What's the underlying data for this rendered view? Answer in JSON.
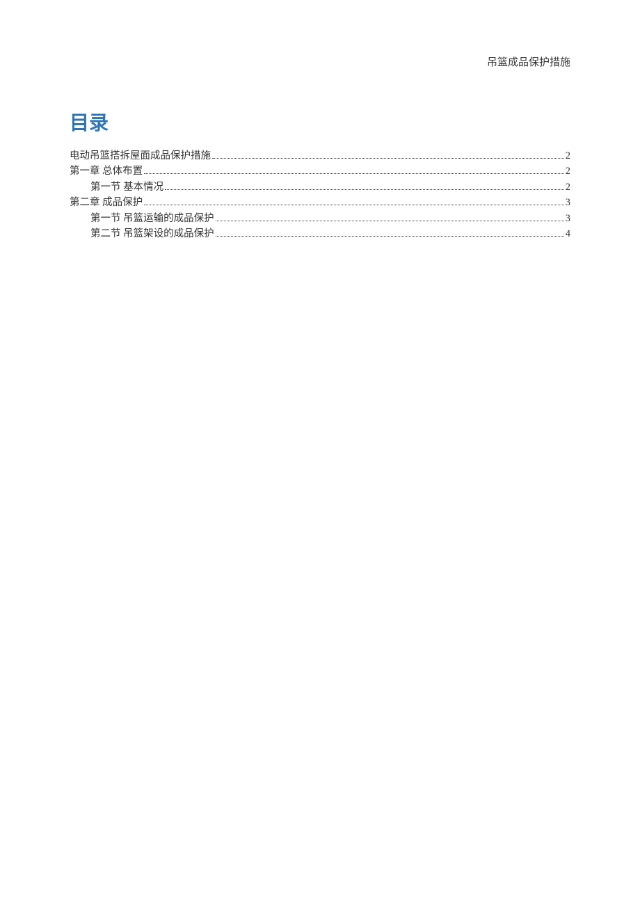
{
  "header": {
    "text": "吊篮成品保护措施"
  },
  "toc": {
    "title": "目录",
    "entries": [
      {
        "label": "电动吊篮搭拆屋面成品保护措施",
        "page": "2",
        "level": 1
      },
      {
        "label": "第一章 总体布置",
        "page": "2",
        "level": 1
      },
      {
        "label": "第一节 基本情况",
        "page": "2",
        "level": 2
      },
      {
        "label": "第二章 成品保护",
        "page": "3",
        "level": 1
      },
      {
        "label": "第一节 吊篮运输的成品保护",
        "page": "3",
        "level": 2
      },
      {
        "label": "第二节 吊篮架设的成品保护",
        "page": "4",
        "level": 2
      }
    ]
  }
}
